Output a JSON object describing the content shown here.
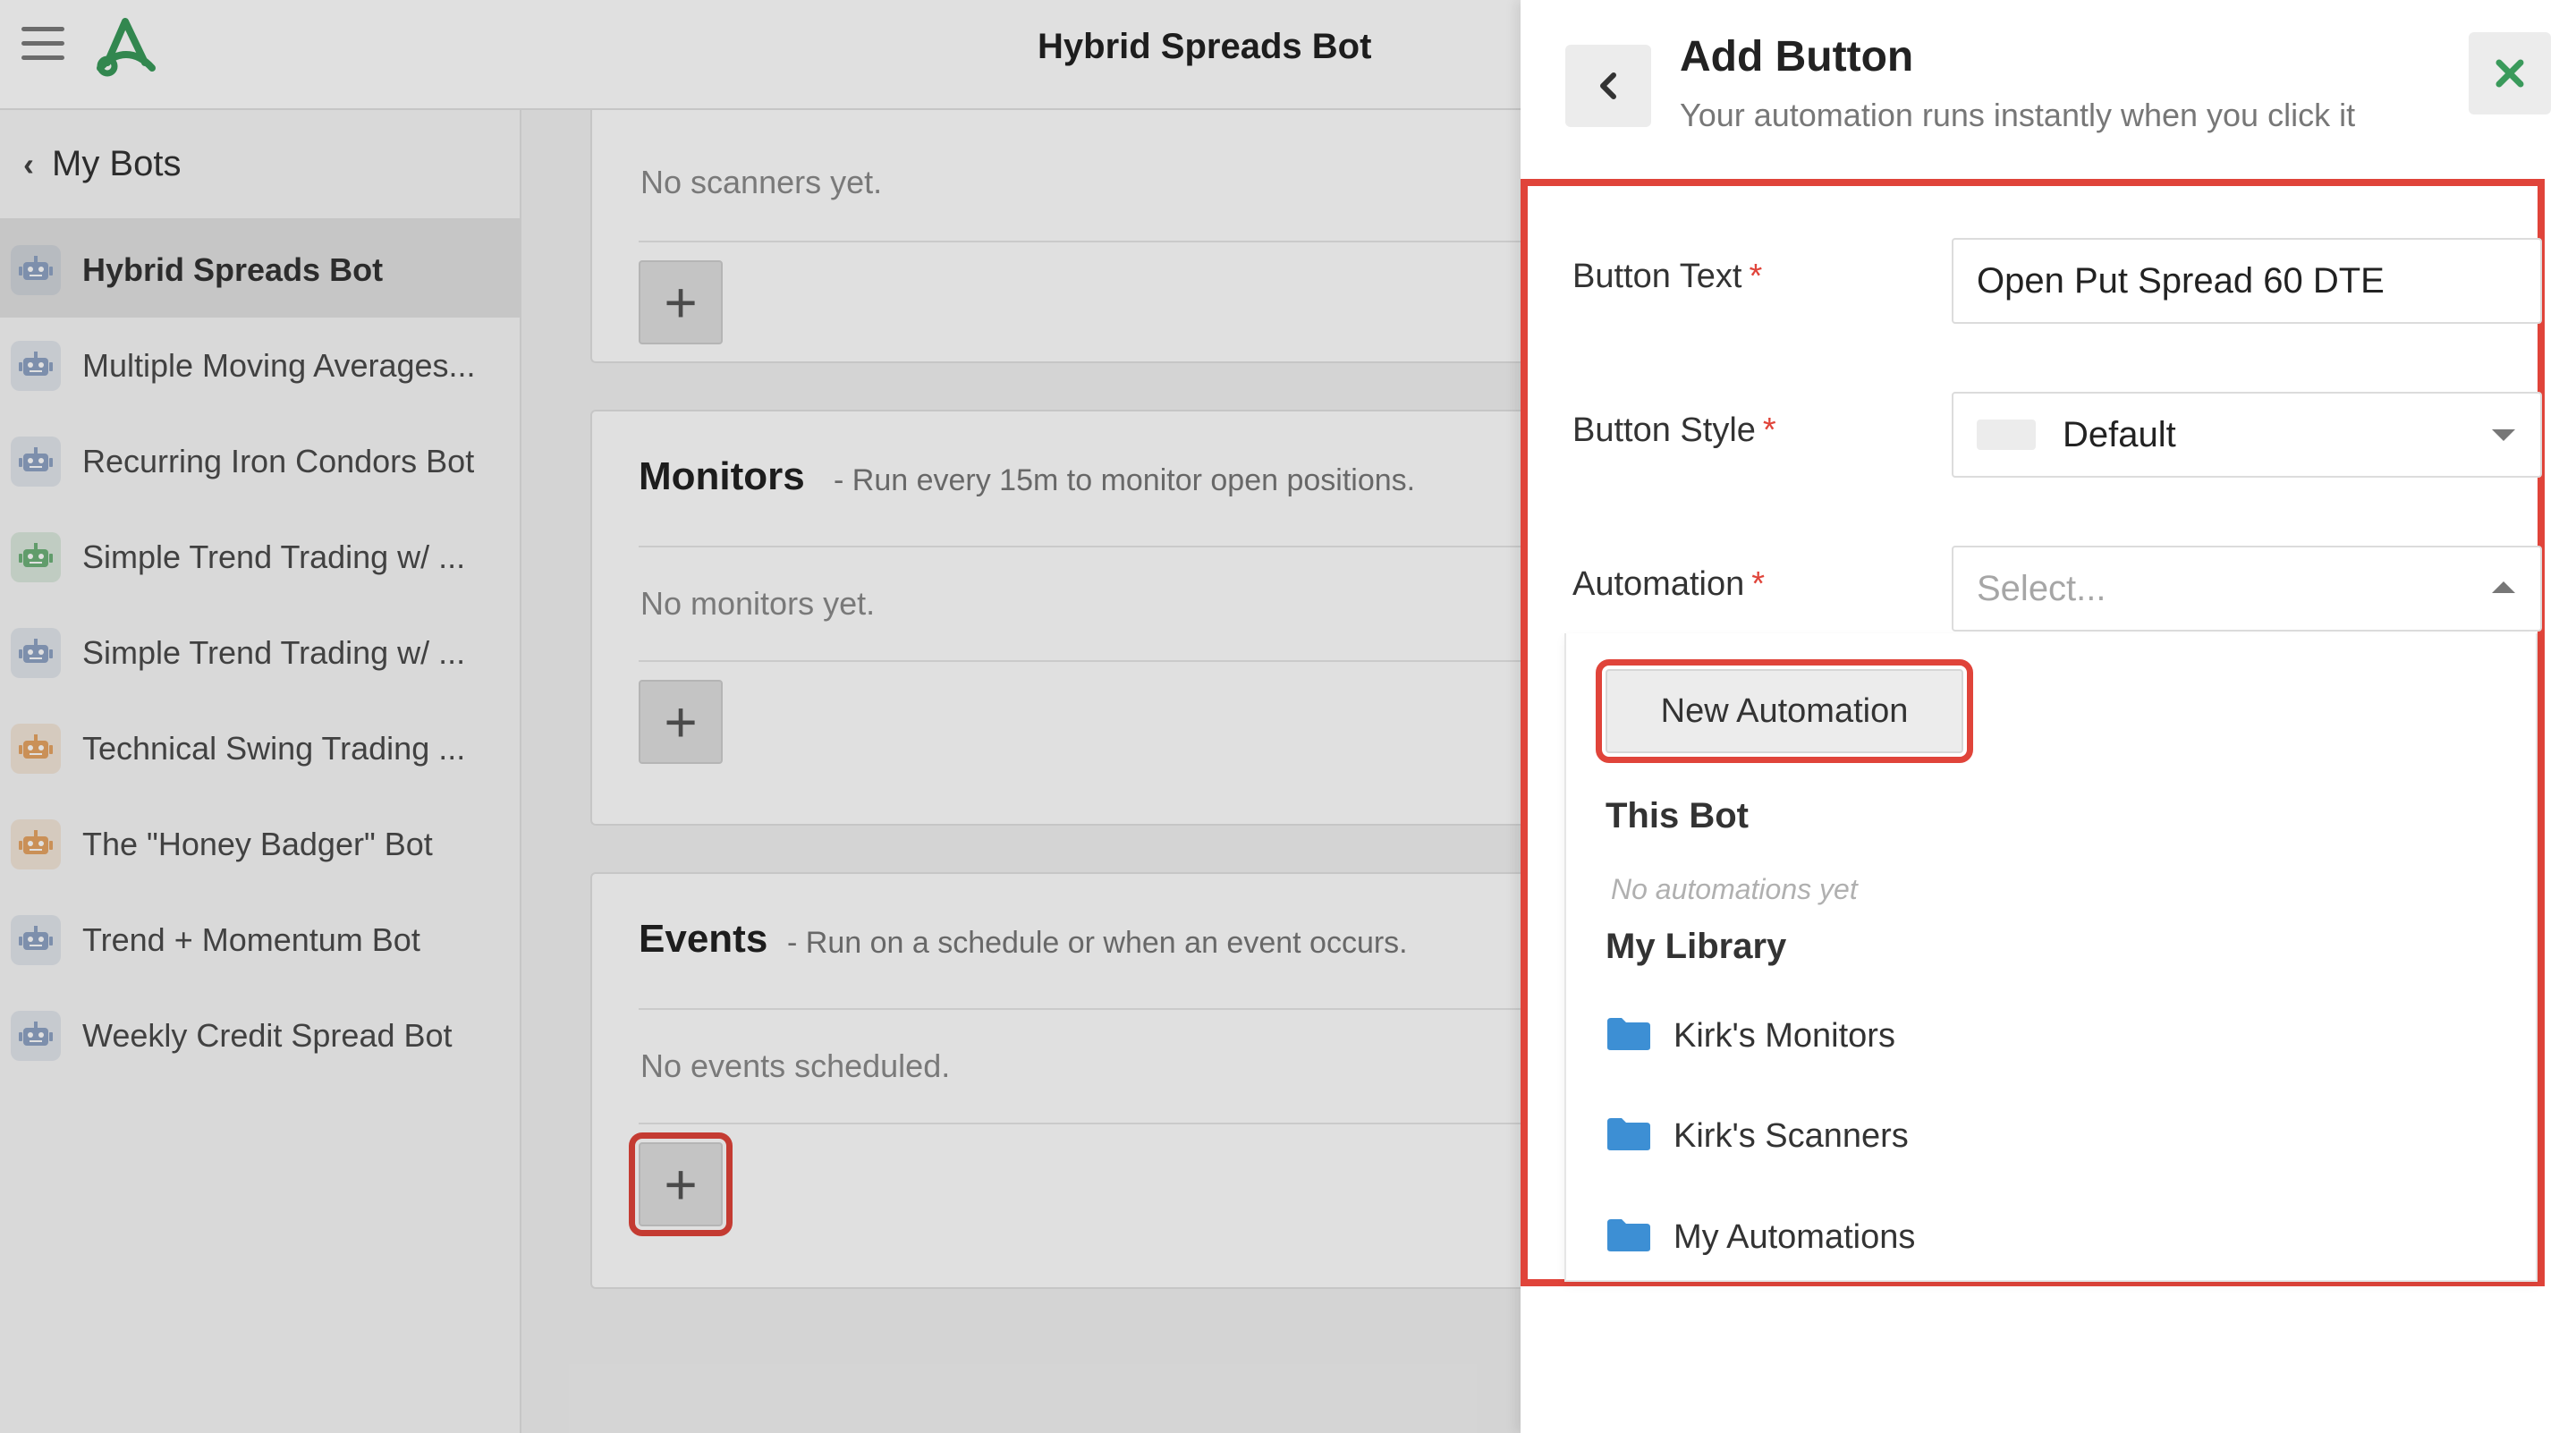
{
  "topbar": {
    "title": "Hybrid Spreads Bot"
  },
  "sidebar": {
    "back_label": "My Bots",
    "bots": [
      {
        "name": "Hybrid Spreads Bot",
        "color": "#8fa3c4",
        "active": true
      },
      {
        "name": "Multiple Moving Averages...",
        "color": "#8fa3c4"
      },
      {
        "name": "Recurring Iron Condors Bot",
        "color": "#8fa3c4"
      },
      {
        "name": "Simple Trend Trading w/ ...",
        "color": "#6fb27a"
      },
      {
        "name": "Simple Trend Trading w/ ...",
        "color": "#8fa3c4"
      },
      {
        "name": "Technical Swing Trading ...",
        "color": "#e6a464"
      },
      {
        "name": "The \"Honey Badger\" Bot",
        "color": "#e6a464"
      },
      {
        "name": "Trend + Momentum Bot",
        "color": "#8fa3c4"
      },
      {
        "name": "Weekly Credit Spread Bot",
        "color": "#8fa3c4"
      }
    ]
  },
  "main": {
    "scanners": {
      "empty_text": "No scanners yet."
    },
    "monitors": {
      "title": "Monitors",
      "subtitle": "- Run every 15m to monitor open positions.",
      "empty_text": "No monitors yet."
    },
    "events": {
      "title": "Events",
      "subtitle": "- Run on a schedule or when an event occurs.",
      "empty_text": "No events scheduled."
    },
    "add_glyph": "+"
  },
  "panel": {
    "title": "Add Button",
    "subtitle": "Your automation runs instantly when you click it",
    "form": {
      "button_text_label": "Button Text",
      "button_text_value": "Open Put Spread 60 DTE",
      "button_style_label": "Button Style",
      "button_style_value": "Default",
      "automation_label": "Automation",
      "automation_placeholder": "Select...",
      "required_mark": "*"
    },
    "dropdown": {
      "new_automation_label": "New Automation",
      "this_bot_heading": "This Bot",
      "this_bot_empty": "No automations yet",
      "library_heading": "My Library",
      "folders": [
        "Kirk's Monitors",
        "Kirk's Scanners",
        "My Automations"
      ]
    }
  },
  "colors": {
    "accent_green": "#3a9a5b",
    "highlight_red": "#e0443a",
    "folder_blue": "#3d8fd4"
  },
  "icons": {
    "menu": "hamburger-icon",
    "logo": "app-logo-icon",
    "bot": "robot-icon",
    "folder": "folder-icon",
    "close": "close-icon",
    "back": "chevron-left-icon"
  }
}
